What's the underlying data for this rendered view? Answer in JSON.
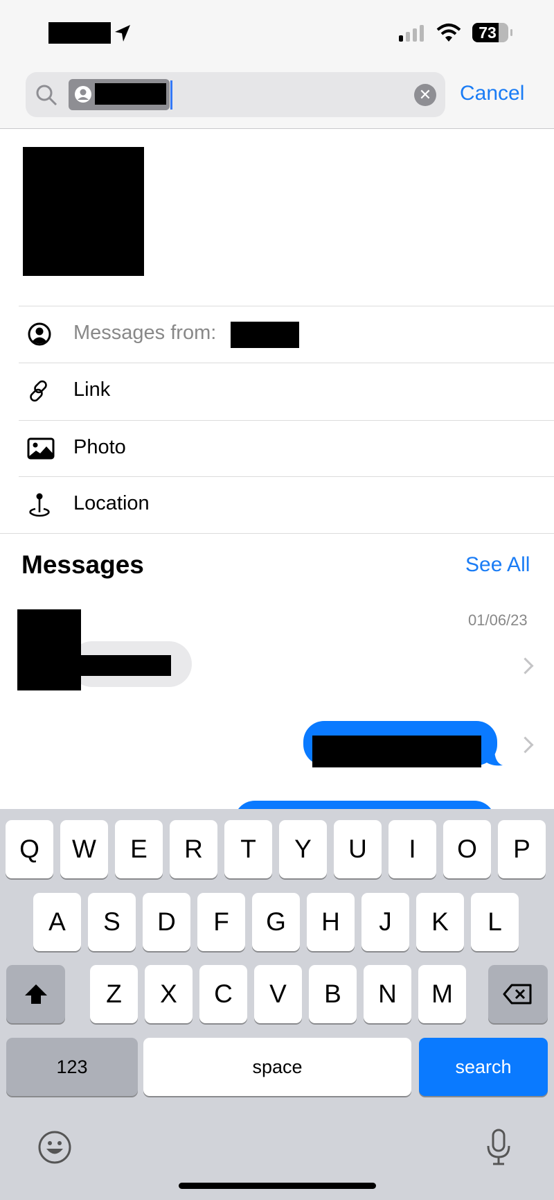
{
  "status_bar": {
    "battery": "73",
    "icons": [
      "location-arrow-icon",
      "signal-icon",
      "wifi-icon",
      "battery-icon"
    ]
  },
  "search": {
    "token_icon": "person-circle-icon",
    "cancel_label": "Cancel",
    "clear_icon": "clear-x-icon"
  },
  "filters": [
    {
      "icon": "person-circle-icon",
      "label": "Messages from:"
    },
    {
      "icon": "link-icon",
      "label": "Link"
    },
    {
      "icon": "photo-icon",
      "label": "Photo"
    },
    {
      "icon": "location-pin-icon",
      "label": "Location"
    }
  ],
  "messages": {
    "title": "Messages",
    "see_all": "See All",
    "results": [
      {
        "date": "01/06/23"
      }
    ]
  },
  "colors": {
    "accent": "#1a7cf5",
    "sent_bubble": "#0a7aff",
    "received_bubble": "#e9e9eb"
  },
  "keyboard": {
    "row1": [
      "Q",
      "W",
      "E",
      "R",
      "T",
      "Y",
      "U",
      "I",
      "O",
      "P"
    ],
    "row2": [
      "A",
      "S",
      "D",
      "F",
      "G",
      "H",
      "J",
      "K",
      "L"
    ],
    "row3": [
      "Z",
      "X",
      "C",
      "V",
      "B",
      "N",
      "M"
    ],
    "numbers_label": "123",
    "space_label": "space",
    "search_label": "search"
  }
}
